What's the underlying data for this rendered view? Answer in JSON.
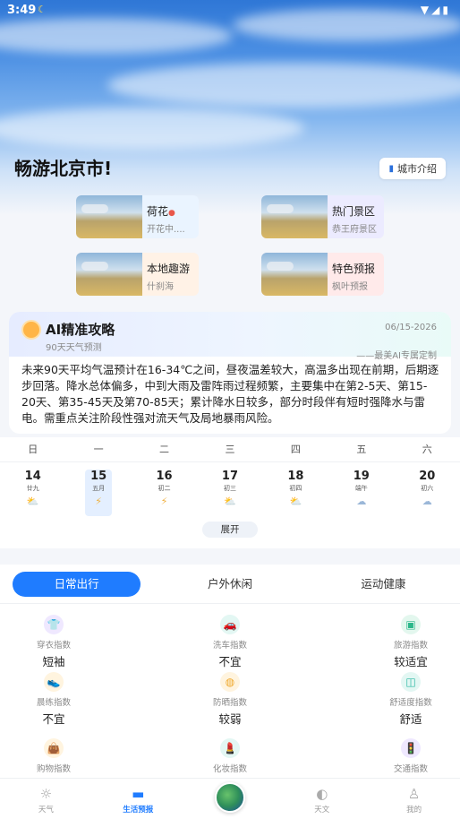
{
  "status_bar": {
    "time": "3:49"
  },
  "header": {
    "headline": "畅游北京市!",
    "city_intro": "城市介绍"
  },
  "tiles": [
    {
      "title": "荷花",
      "subtitle": "开花中...."
    },
    {
      "title": "热门景区",
      "subtitle": "恭王府景区"
    },
    {
      "title": "本地趣游",
      "subtitle": "什刹海"
    },
    {
      "title": "特色预报",
      "subtitle": "枫叶预报"
    }
  ],
  "ai_card": {
    "title": "AI精准攻略",
    "subtitle": "90天天气预测",
    "date": "06/15-2026",
    "custom": "——最美AI专属定制",
    "body": "未来90天平均气温预计在16-34℃之间，昼夜温差较大，高温多出现在前期，后期逐步回落。降水总体偏多，中到大雨及雷阵雨过程频繁，主要集中在第2-5天、第15-20天、第35-45天及第70-85天；累计降水日较多，部分时段伴有短时强降水与雷电。需重点关注阶段性强对流天气及局地暴雨风险。"
  },
  "week": {
    "headers": [
      "日",
      "一",
      "二",
      "三",
      "四",
      "五",
      "六"
    ],
    "days": [
      {
        "num": "14",
        "lunar": "廿九",
        "wx": "⛅"
      },
      {
        "num": "15",
        "lunar": "五月",
        "wx": "⚡"
      },
      {
        "num": "16",
        "lunar": "初二",
        "wx": "⚡"
      },
      {
        "num": "17",
        "lunar": "初三",
        "wx": "⛅"
      },
      {
        "num": "18",
        "lunar": "初四",
        "wx": "⛅"
      },
      {
        "num": "19",
        "lunar": "端午",
        "wx": "☁"
      },
      {
        "num": "20",
        "lunar": "初六",
        "wx": "☁"
      }
    ],
    "selected_index": 1,
    "expand_label": "展开"
  },
  "life": {
    "tabs": [
      "日常出行",
      "户外休闲",
      "运动健康"
    ],
    "indices": [
      {
        "label": "穿衣指数",
        "value": "短袖",
        "icon": "shirt-icon",
        "color": "#8a5cf6"
      },
      {
        "label": "洗车指数",
        "value": "不宜",
        "icon": "car-icon",
        "color": "#2bb7a3"
      },
      {
        "label": "旅游指数",
        "value": "较适宜",
        "icon": "luggage-icon",
        "color": "#2bb78a"
      },
      {
        "label": "晨练指数",
        "value": "不宜",
        "icon": "sneaker-icon",
        "color": "#f0a92e"
      },
      {
        "label": "防晒指数",
        "value": "较弱",
        "icon": "sunscreen-icon",
        "color": "#f0a92e"
      },
      {
        "label": "舒适度指数",
        "value": "舒适",
        "icon": "sofa-icon",
        "color": "#2bb7a3"
      },
      {
        "label": "购物指数",
        "value": "",
        "icon": "bag-icon",
        "color": "#f0a92e"
      },
      {
        "label": "化妆指数",
        "value": "",
        "icon": "lipstick-icon",
        "color": "#2bb7a3"
      },
      {
        "label": "交通指数",
        "value": "",
        "icon": "traffic-light-icon",
        "color": "#8a5cf6"
      }
    ]
  },
  "nav": [
    {
      "label": "天气",
      "icon": "sun-icon"
    },
    {
      "label": "生活预报",
      "icon": "folder-icon"
    },
    {
      "label": "",
      "icon": "globe-icon"
    },
    {
      "label": "天文",
      "icon": "planet-icon"
    },
    {
      "label": "我的",
      "icon": "user-icon"
    }
  ]
}
